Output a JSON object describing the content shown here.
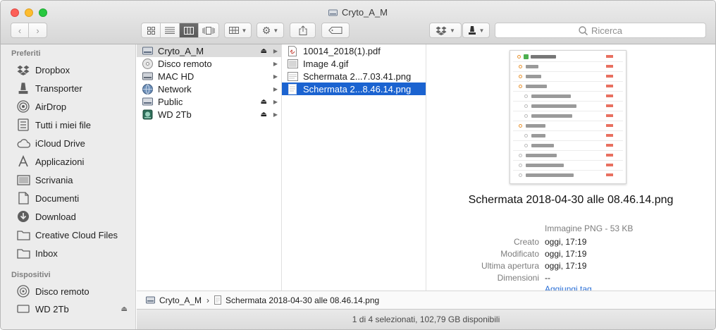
{
  "window": {
    "title": "Cryto_A_M"
  },
  "toolbar": {
    "search_placeholder": "Ricerca"
  },
  "sidebar": {
    "favorites_header": "Preferiti",
    "favorites": [
      {
        "label": "Dropbox",
        "icon": "dropbox-icon"
      },
      {
        "label": "Transporter",
        "icon": "transporter-icon"
      },
      {
        "label": "AirDrop",
        "icon": "airdrop-icon"
      },
      {
        "label": "Tutti i miei file",
        "icon": "all-files-icon"
      },
      {
        "label": "iCloud Drive",
        "icon": "cloud-icon"
      },
      {
        "label": "Applicazioni",
        "icon": "applications-icon"
      },
      {
        "label": "Scrivania",
        "icon": "desktop-icon"
      },
      {
        "label": "Documenti",
        "icon": "document-icon"
      },
      {
        "label": "Download",
        "icon": "download-icon"
      },
      {
        "label": "Creative Cloud Files",
        "icon": "folder-icon"
      },
      {
        "label": "Inbox",
        "icon": "folder-icon"
      }
    ],
    "devices_header": "Dispositivi",
    "devices": [
      {
        "label": "Disco remoto",
        "icon": "remote-disc-icon"
      },
      {
        "label": "WD 2Tb",
        "icon": "drive-icon"
      }
    ]
  },
  "columns": {
    "volumes": [
      {
        "label": "Cryto_A_M",
        "eject": true,
        "selected": true
      },
      {
        "label": "Disco remoto",
        "eject": false
      },
      {
        "label": "MAC HD",
        "eject": false
      },
      {
        "label": "Network",
        "eject": false
      },
      {
        "label": "Public",
        "eject": true
      },
      {
        "label": "WD 2Tb",
        "eject": true
      }
    ],
    "files": [
      {
        "label": "10014_2018(1).pdf"
      },
      {
        "label": "Image 4.gif"
      },
      {
        "label": "Schermata 2...7.03.41.png"
      },
      {
        "label": "Schermata 2...8.46.14.png",
        "selected": true
      }
    ]
  },
  "preview": {
    "file_name": "Schermata 2018-04-30 alle 08.46.14.png",
    "kind": "Immagine PNG - 53 KB",
    "created_label": "Creato",
    "created_value": "oggi, 17:19",
    "modified_label": "Modificato",
    "modified_value": "oggi, 17:19",
    "opened_label": "Ultima apertura",
    "opened_value": "oggi, 17:19",
    "dimensions_label": "Dimensioni",
    "dimensions_value": "--",
    "add_tags": "Aggiungi tag..."
  },
  "pathbar": {
    "volume": "Cryto_A_M",
    "file": "Schermata 2018-04-30 alle 08.46.14.png"
  },
  "status": "1 di 4 selezionati, 102,79 GB disponibili",
  "colors": {
    "selection_blue": "#1b63d0",
    "sidebar_bg": "#ececec",
    "link_blue": "#2a6fd6"
  }
}
